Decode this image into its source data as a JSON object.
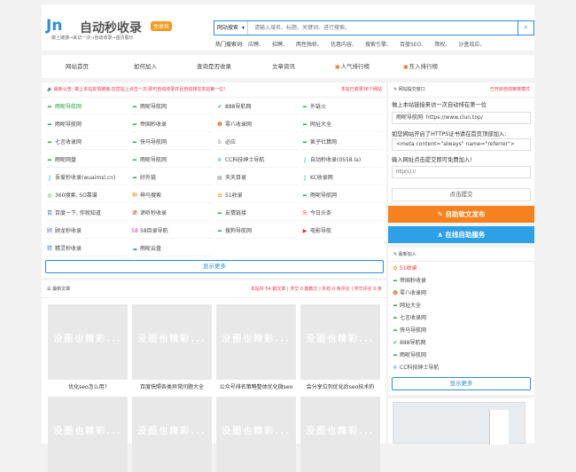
{
  "header": {
    "logo_mark": "Jn",
    "logo_text": "自动秒收录",
    "logo_badge": "免审核",
    "slogan": "做上链接→来访一次→自动收录→首页展示",
    "search_select": "网站搜索",
    "search_placeholder": "请输入域名、标题、关键词、进行搜索。",
    "hot_title": "热门搜索词:",
    "hot_words": [
      "应聘、",
      "招聘、",
      "两性独栋、",
      "优惠内容、",
      "搜索引擎、",
      "百度SEO、",
      "降权、",
      "沙盒效应、"
    ]
  },
  "nav": {
    "items": [
      {
        "label": "网站首页",
        "icon": ""
      },
      {
        "label": "如何加入",
        "icon": ""
      },
      {
        "label": "查询是否收录",
        "icon": ""
      },
      {
        "label": "文章资讯",
        "icon": ""
      },
      {
        "label": "人气排行榜",
        "icon": "rank-icon"
      },
      {
        "label": "东入排行榜",
        "icon": "rank-icon"
      }
    ]
  },
  "sites_panel": {
    "notice": "最新公告: 做上本站友情链接,在您站上点击一次,即可自动收录并且自动排在本站第一位!",
    "count_text": "本站已收录36个网站",
    "items": [
      {
        "name": "雨呢导航网",
        "icon": "arrow-icon",
        "color": "#2aa34a",
        "highlight": true
      },
      {
        "name": "雨呢导航网",
        "icon": "arrow-icon",
        "color": "#2aa34a"
      },
      {
        "name": "888导航网",
        "icon": "check-shield-icon",
        "color": "#2aa34a"
      },
      {
        "name": "外链火",
        "icon": "arrow-icon",
        "color": "#2aa34a"
      },
      {
        "name": "雨呢导航网",
        "icon": "arrow-icon",
        "color": "#2aa34a"
      },
      {
        "name": "帝国秒收录",
        "icon": "arrow-icon",
        "color": "#2aa34a"
      },
      {
        "name": "零八收录网",
        "icon": "avatar-icon",
        "color": "#c84"
      },
      {
        "name": "网址大全",
        "icon": "arrow-icon",
        "color": "#2aa34a"
      },
      {
        "name": "七言收录网",
        "icon": "arrow-icon",
        "color": "#2aa34a"
      },
      {
        "name": "快马导航网",
        "icon": "arrow-icon",
        "color": "#2aa34a"
      },
      {
        "name": "必应",
        "icon": "bing-icon",
        "color": "#888"
      },
      {
        "name": "疯子社算网",
        "icon": "arrow-icon",
        "color": "#2aa34a"
      },
      {
        "name": "雨呢网盘",
        "icon": "arrow-icon",
        "color": "#2aa34a"
      },
      {
        "name": "雨呢导航网",
        "icon": "arrow-icon",
        "color": "#2aa34a"
      },
      {
        "name": "CC科技绅士导航",
        "icon": "snow-icon",
        "color": "#5ab"
      },
      {
        "name": "自动秒收录(0558.la)",
        "icon": "logo-icon",
        "color": "#2e8cd6"
      },
      {
        "name": "吾爱秒收录(wuaimsl.cn)",
        "icon": "logo-icon",
        "color": "#2e8cd6"
      },
      {
        "name": "好外链",
        "icon": "arrow-icon",
        "color": "#2aa34a"
      },
      {
        "name": "天天目录",
        "icon": "doc-icon",
        "color": "#888"
      },
      {
        "name": "KC收录网",
        "icon": "logo-icon",
        "color": "#2e8cd6"
      },
      {
        "name": "360搜索, SO靠谱",
        "icon": "360-icon",
        "color": "#3a3"
      },
      {
        "name": "神马搜索",
        "icon": "shenma-icon",
        "color": "#e80"
      },
      {
        "name": "51收录",
        "icon": "flower-icon",
        "color": "#e90"
      },
      {
        "name": "雨呢导航网",
        "icon": "arrow-icon",
        "color": "#2aa34a"
      },
      {
        "name": "百度一下, 你就知道",
        "icon": "baidu-icon",
        "color": "#36c"
      },
      {
        "name": "谛听秒收录",
        "icon": "diting-icon",
        "color": "#c33"
      },
      {
        "name": "友情链接",
        "icon": "arrow-icon",
        "color": "#2aa34a"
      },
      {
        "name": "今日头条",
        "icon": "toutiao-icon",
        "color": "#e33"
      },
      {
        "name": "顾龙秒收录",
        "icon": "gu-icon",
        "color": "#66c"
      },
      {
        "name": "58目录导航",
        "icon": "58-icon",
        "color": "#c3c"
      },
      {
        "name": "搜狗导航网",
        "icon": "arrow-icon",
        "color": "#2aa34a"
      },
      {
        "name": "电影导航",
        "icon": "play-icon",
        "color": "#e22"
      },
      {
        "name": "精灵秒收录",
        "icon": "elf-icon",
        "color": "#39c"
      },
      {
        "name": "雨呢云盘",
        "icon": "cloud-icon",
        "color": "#39c"
      }
    ],
    "more_label": "显示更多"
  },
  "articles_panel": {
    "title": "最新文章",
    "stats": "本站共 54 篇文章 | 浮华 0 篇教文 | 共有 0 条评论 | 浮华评论 0 条",
    "watermark": "没图也精彩...",
    "items": [
      {
        "caption": "优化seo怎么用?"
      },
      {
        "caption": "百度快照各类异常问题大全"
      },
      {
        "caption": "公众号排名策略整体优化微seo"
      },
      {
        "caption": "会分享位列优化后seo技术的"
      }
    ]
  },
  "sidebar": {
    "submit_title": "网站提交窗口",
    "submit_link": "已开启自动审核模式",
    "tip1": "做上本站链接来访一次自动排在第一位",
    "site_url_field": "雨呢导航网: https://www.clun.top/",
    "tip2": "如您网站开启了HTTPS证书请在首页顶部加入:",
    "meta_field": "<meta content=\"always\" name=\"referrer\">",
    "tip3": "输入网址点击提交即可免费加入!",
    "url_placeholder": "http(s)://",
    "submit_label": "点击提交",
    "publish_label": "自助软文发布",
    "service_label": "在线自助服务",
    "new_title": "最新加入",
    "new_items": [
      {
        "name": "51收录",
        "icon": "flower-icon",
        "color": "#e90",
        "highlight": true
      },
      {
        "name": "帝国秒收录",
        "icon": "arrow-icon",
        "color": "#2aa34a"
      },
      {
        "name": "零八收录网",
        "icon": "avatar-icon",
        "color": "#c84"
      },
      {
        "name": "网址大全",
        "icon": "arrow-icon",
        "color": "#2aa34a"
      },
      {
        "name": "七言收录网",
        "icon": "arrow-icon",
        "color": "#2aa34a"
      },
      {
        "name": "快马导航网",
        "icon": "arrow-icon",
        "color": "#2aa34a"
      },
      {
        "name": "888导航网",
        "icon": "check-shield-icon",
        "color": "#2aa34a"
      },
      {
        "name": "雨呢导航网",
        "icon": "arrow-icon",
        "color": "#2aa34a"
      },
      {
        "name": "CC科技绅士导航",
        "icon": "snow-icon",
        "color": "#5ab"
      }
    ],
    "more_label": "显示更多"
  },
  "colors": {
    "accent": "#2e8cd6",
    "orange": "#f5811f",
    "green": "#2aa34a",
    "red": "#e33"
  }
}
